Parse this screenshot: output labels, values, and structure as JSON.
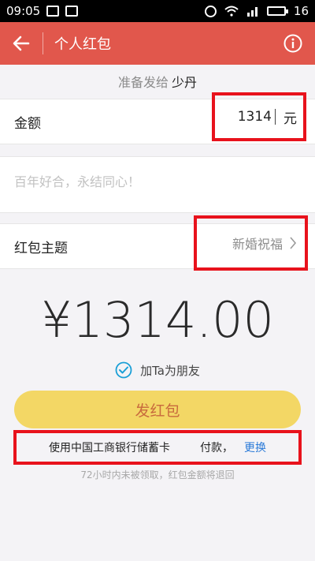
{
  "status_bar": {
    "time": "09:05",
    "battery": "16"
  },
  "nav": {
    "title": "个人红包"
  },
  "recipient": {
    "prefix": "准备发给",
    "name": "少丹"
  },
  "amount": {
    "label": "金额",
    "value": "1314",
    "unit": "元"
  },
  "message": {
    "placeholder": "百年好合，永结同心！"
  },
  "theme": {
    "label": "红包主题",
    "value": "新婚祝福"
  },
  "display_amount": "¥1314.00",
  "friend": {
    "label": "加Ta为朋友"
  },
  "send_button": {
    "label": "发红包"
  },
  "payment": {
    "text_before": "使用中国工商银行储蓄卡",
    "text_after": "付款，",
    "change_label": "更换"
  },
  "notice": {
    "text": "72小时内未被领取，红包金额将退回"
  },
  "colors": {
    "nav": "#e1574c",
    "button": "#f3d765",
    "button_text": "#c86a3d",
    "link": "#2a7ad8",
    "highlight": "#e8121c"
  }
}
